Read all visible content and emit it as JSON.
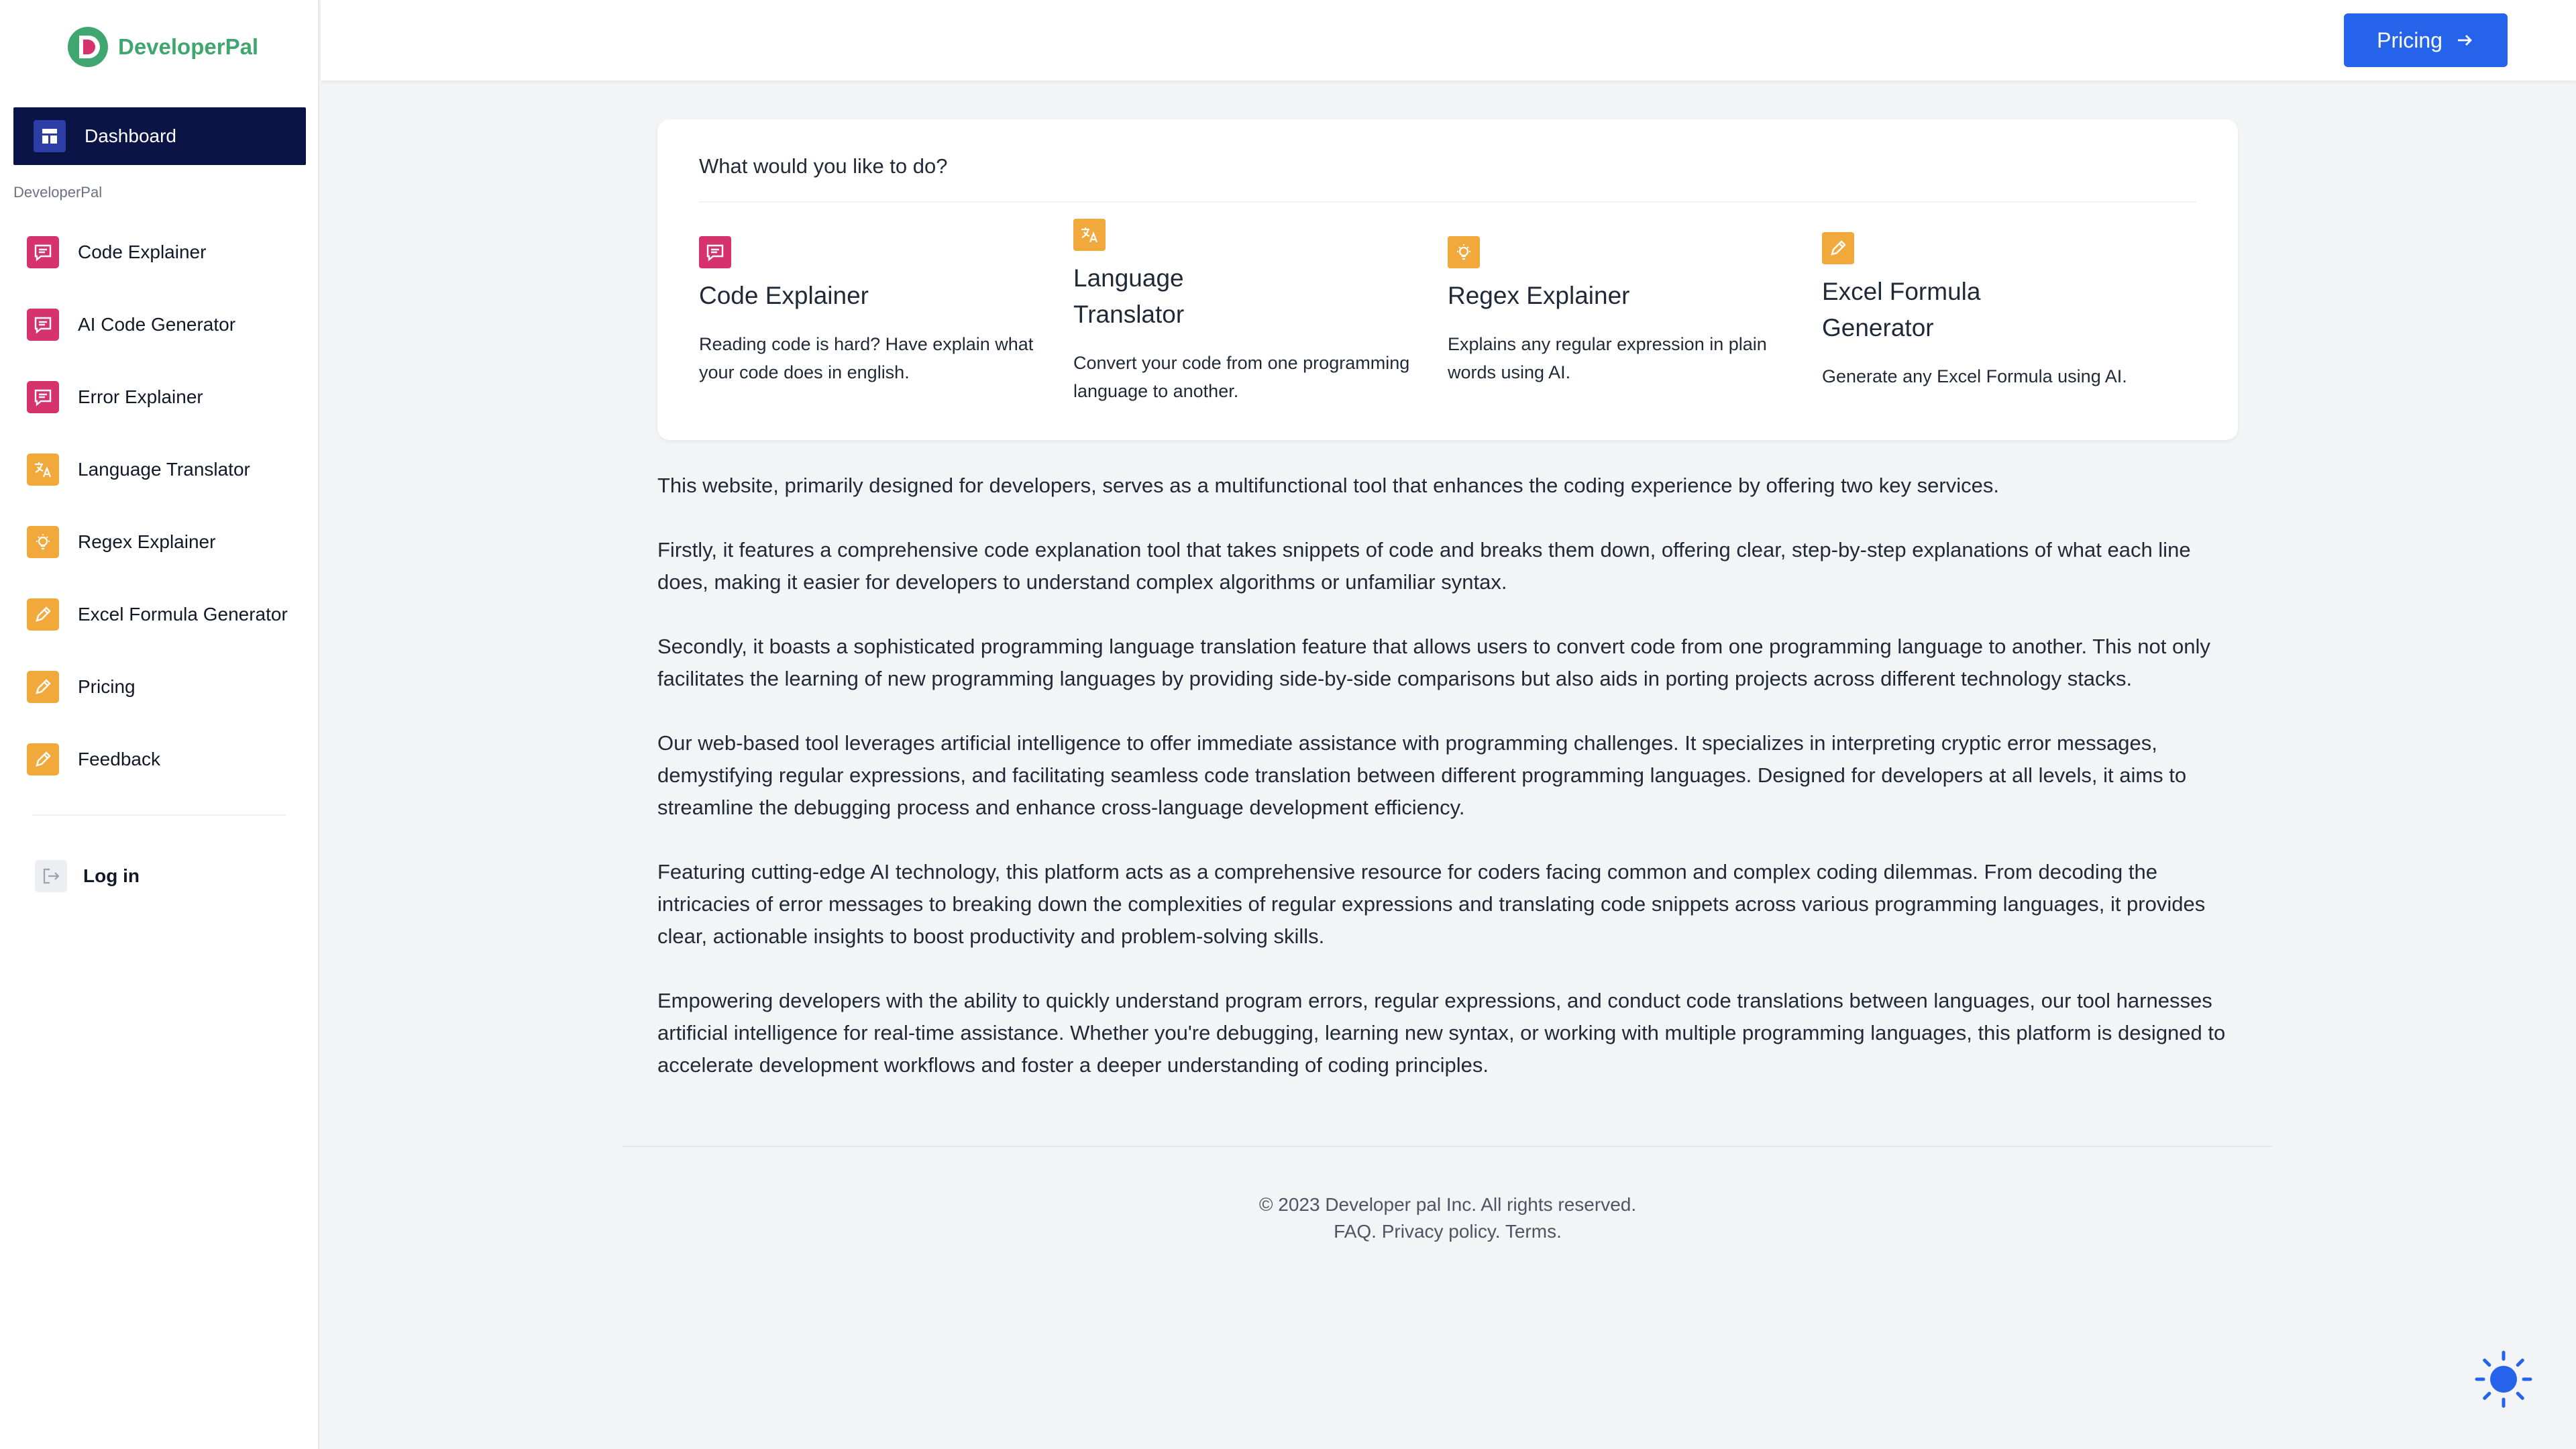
{
  "brand": {
    "name": "DeveloperPal",
    "color": "#3fa66f"
  },
  "sidebar": {
    "dashboard_label": "Dashboard",
    "section_label": "DeveloperPal",
    "items": [
      {
        "label": "Code Explainer",
        "icon": "message-icon",
        "color": "#d6336c"
      },
      {
        "label": "AI Code Generator",
        "icon": "message-icon",
        "color": "#d6336c"
      },
      {
        "label": "Error Explainer",
        "icon": "message-icon",
        "color": "#d6336c"
      },
      {
        "label": "Language Translator",
        "icon": "translate-icon",
        "color": "#f0a93a"
      },
      {
        "label": "Regex Explainer",
        "icon": "bulb-icon",
        "color": "#f0a93a"
      },
      {
        "label": "Excel Formula Generator",
        "icon": "pencil-icon",
        "color": "#f0a93a"
      },
      {
        "label": "Pricing",
        "icon": "pencil-icon",
        "color": "#f0a93a"
      },
      {
        "label": "Feedback",
        "icon": "pencil-icon",
        "color": "#f0a93a"
      }
    ],
    "login_label": "Log in"
  },
  "header": {
    "pricing_label": "Pricing",
    "accent": "#2563eb"
  },
  "card": {
    "title": "What would you like to do?",
    "tools": [
      {
        "title": "Code Explainer",
        "desc": "Reading code is hard? Have explain what your code does in english."
      },
      {
        "title_line1": "Language",
        "title_line2": "Translator",
        "desc": "Convert your code from one programming language to another."
      },
      {
        "title": "Regex Explainer",
        "desc": "Explains any regular expression in plain words using AI."
      },
      {
        "title_line1": "Excel Formula",
        "title_line2": "Generator",
        "desc": "Generate any Excel Formula using AI."
      }
    ]
  },
  "paragraphs": [
    "This website, primarily designed for developers, serves as a multifunctional tool that enhances the coding experience by offering two key services.",
    "Firstly, it features a comprehensive code explanation tool that takes snippets of code and breaks them down, offering clear, step-by-step explanations of what each line does, making it easier for developers to understand complex algorithms or unfamiliar syntax.",
    "Secondly, it boasts a sophisticated programming language translation feature that allows users to convert code from one programming language to another. This not only facilitates the learning of new programming languages by providing side-by-side comparisons but also aids in porting projects across different technology stacks.",
    "Our web-based tool leverages artificial intelligence to offer immediate assistance with programming challenges. It specializes in interpreting cryptic error messages, demystifying regular expressions, and facilitating seamless code translation between different programming languages. Designed for developers at all levels, it aims to streamline the debugging process and enhance cross-language development efficiency.",
    "Featuring cutting-edge AI technology, this platform acts as a comprehensive resource for coders facing common and complex coding dilemmas. From decoding the intricacies of error messages to breaking down the complexities of regular expressions and translating code snippets across various programming languages, it provides clear, actionable insights to boost productivity and problem-solving skills.",
    "Empowering developers with the ability to quickly understand program errors, regular expressions, and conduct code translations between languages, our tool harnesses artificial intelligence for real-time assistance. Whether you're debugging, learning new syntax, or working with multiple programming languages, this platform is designed to accelerate development workflows and foster a deeper understanding of coding principles."
  ],
  "footer": {
    "copyright": "© 2023 Developer pal Inc. All rights reserved.",
    "faq": "FAQ.",
    "privacy": "Privacy policy.",
    "terms": "Terms."
  }
}
